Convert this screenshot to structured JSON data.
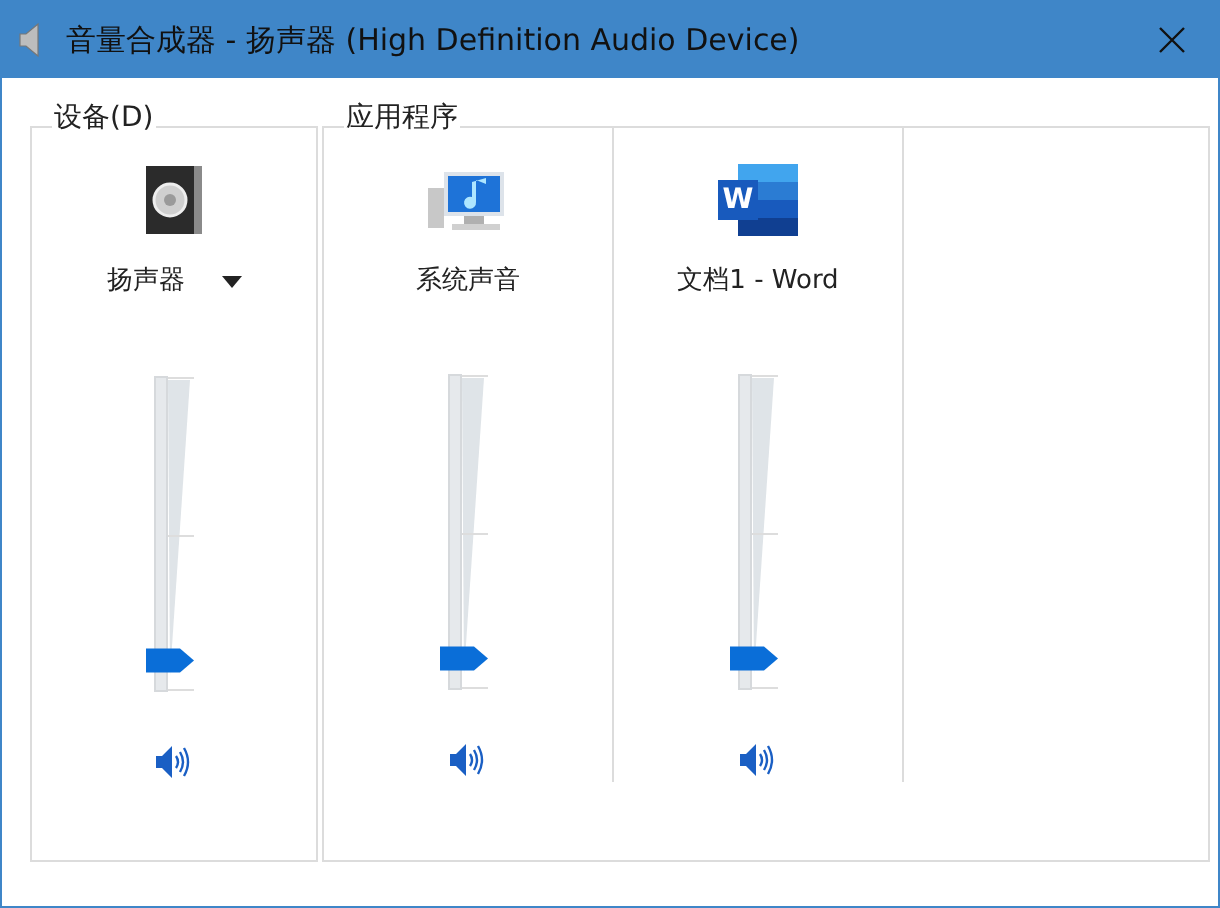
{
  "window": {
    "title": "音量合成器 - 扬声器 (High Definition Audio Device)"
  },
  "devices": {
    "label": "设备(D)",
    "channels": [
      {
        "kind": "speaker",
        "name": "扬声器",
        "dropdown": true,
        "level": 0.1,
        "muted": false
      }
    ]
  },
  "applications": {
    "label": "应用程序",
    "channels": [
      {
        "kind": "system-sounds",
        "name": "系统声音",
        "level": 0.1,
        "muted": false
      },
      {
        "kind": "word",
        "name": "文档1 - Word",
        "logo_letter": "W",
        "level": 0.1,
        "muted": false
      }
    ]
  }
}
